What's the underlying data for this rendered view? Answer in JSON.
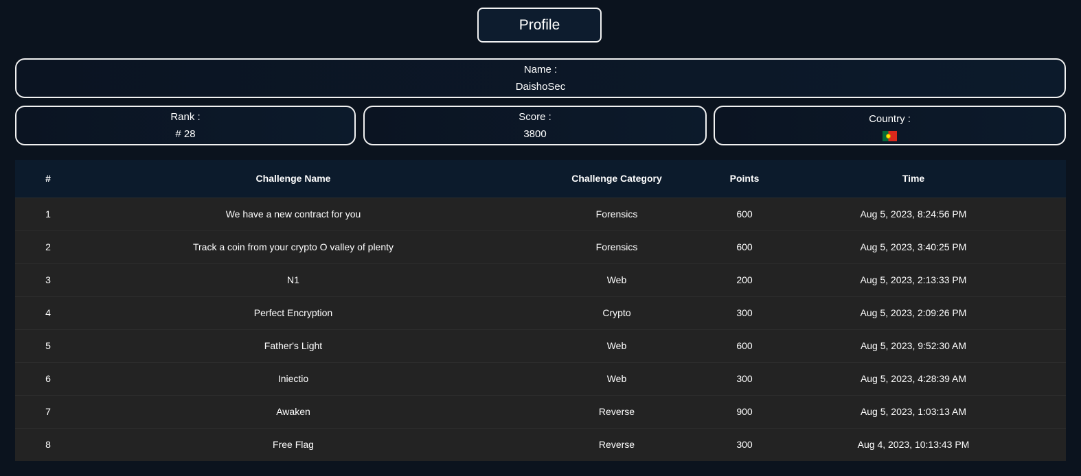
{
  "title": "Profile",
  "name": {
    "label": "Name :",
    "value": "DaishoSec"
  },
  "rank": {
    "label": "Rank :",
    "value": "# 28"
  },
  "score": {
    "label": "Score :",
    "value": "3800"
  },
  "country": {
    "label": "Country :",
    "flag_icon": "portugal-flag-icon"
  },
  "table": {
    "headers": [
      "#",
      "Challenge Name",
      "Challenge Category",
      "Points",
      "Time"
    ],
    "rows": [
      [
        "1",
        "We have a new contract for you",
        "Forensics",
        "600",
        "Aug 5, 2023, 8:24:56 PM"
      ],
      [
        "2",
        "Track a coin from your crypto O valley of plenty",
        "Forensics",
        "600",
        "Aug 5, 2023, 3:40:25 PM"
      ],
      [
        "3",
        "N1",
        "Web",
        "200",
        "Aug 5, 2023, 2:13:33 PM"
      ],
      [
        "4",
        "Perfect Encryption",
        "Crypto",
        "300",
        "Aug 5, 2023, 2:09:26 PM"
      ],
      [
        "5",
        "Father's Light",
        "Web",
        "600",
        "Aug 5, 2023, 9:52:30 AM"
      ],
      [
        "6",
        "Iniectio",
        "Web",
        "300",
        "Aug 5, 2023, 4:28:39 AM"
      ],
      [
        "7",
        "Awaken",
        "Reverse",
        "900",
        "Aug 5, 2023, 1:03:13 AM"
      ],
      [
        "8",
        "Free Flag",
        "Reverse",
        "300",
        "Aug 4, 2023, 10:13:43 PM"
      ]
    ]
  }
}
